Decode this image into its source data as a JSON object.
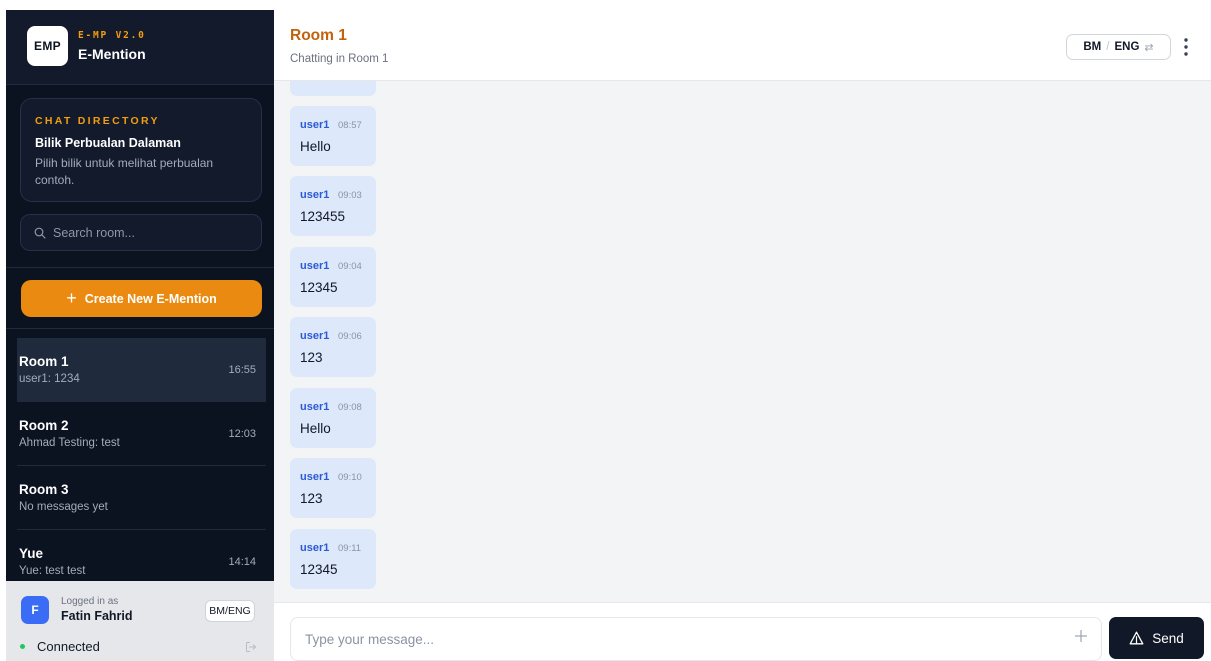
{
  "brand": {
    "logo": "EMP",
    "version": "E-MP V2.0",
    "name": "E-Mention"
  },
  "directory": {
    "overline": "CHAT DIRECTORY",
    "title": "Bilik Perbualan Dalaman",
    "description": "Pilih bilik untuk melihat perbualan contoh."
  },
  "search": {
    "placeholder": "Search room...",
    "icon": "search-icon"
  },
  "create_button": {
    "label": "Create New E-Mention",
    "icon": "plus-icon"
  },
  "rooms": [
    {
      "name": "Room 1",
      "preview": "user1: 1234",
      "time": "16:55",
      "active": true
    },
    {
      "name": "Room 2",
      "preview": "Ahmad Testing: test",
      "time": "12:03",
      "active": false
    },
    {
      "name": "Room 3",
      "preview": "No messages yet",
      "time": "",
      "active": false
    },
    {
      "name": "Yue",
      "preview": "Yue: test test",
      "time": "14:14",
      "active": false
    }
  ],
  "user": {
    "avatar_letter": "F",
    "logged_label": "Logged in as",
    "name": "Fatin Fahrid",
    "lang_toggle": "BM/ENG",
    "status": "Connected",
    "status_color": "#22c55e"
  },
  "header": {
    "title": "Room 1",
    "subtitle": "Chatting in Room 1",
    "lang_primary": "BM",
    "lang_separator": "/",
    "lang_secondary": "ENG",
    "lang_swap_icon": "swap-icon",
    "menu_icon": "more-vertical-icon"
  },
  "messages": [
    {
      "author": "user1",
      "time": "08:57",
      "text": "Hello"
    },
    {
      "author": "user1",
      "time": "09:03",
      "text": "123455"
    },
    {
      "author": "user1",
      "time": "09:04",
      "text": "12345"
    },
    {
      "author": "user1",
      "time": "09:06",
      "text": "123"
    },
    {
      "author": "user1",
      "time": "09:08",
      "text": "Hello"
    },
    {
      "author": "user1",
      "time": "09:10",
      "text": "123"
    },
    {
      "author": "user1",
      "time": "09:11",
      "text": "12345"
    }
  ],
  "composer": {
    "placeholder": "Type your message...",
    "send_label": "Send",
    "add_icon": "plus-icon",
    "send_icon": "send-icon"
  },
  "colors": {
    "accent": "#ea8a10",
    "sidebar": "#0b1220",
    "bubble": "#dde8fb",
    "author": "#2b5ad6",
    "title": "#c2620a"
  }
}
